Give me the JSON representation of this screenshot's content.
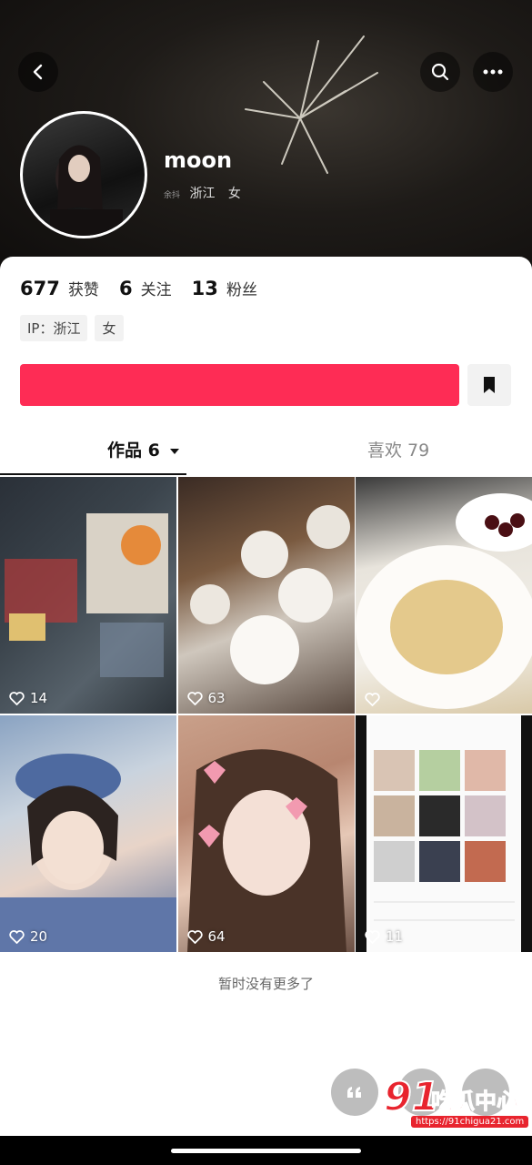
{
  "profile": {
    "username": "moon",
    "location_small": "余抖",
    "location": "浙江",
    "gender": "女"
  },
  "stats": {
    "likes_count": "677",
    "likes_label": "获赞",
    "following_count": "6",
    "following_label": "关注",
    "followers_count": "13",
    "followers_label": "粉丝"
  },
  "tags": {
    "ip": "IP：浙江",
    "gender": "女"
  },
  "follow_button": {
    "label": ""
  },
  "tabs": {
    "works": "作品 6",
    "likes": "喜欢 79"
  },
  "videos": [
    {
      "likes": "14"
    },
    {
      "likes": "63"
    },
    {
      "likes": ""
    },
    {
      "likes": "20"
    },
    {
      "likes": "64"
    },
    {
      "likes": "11"
    }
  ],
  "footer": {
    "no_more": "暂时没有更多了"
  },
  "watermark": {
    "number": "91",
    "text": "吃瓜中心",
    "url": "https://91chigua21.com"
  },
  "colors": {
    "accent": "#fe2c55",
    "watermark": "#e8242e"
  },
  "icons": [
    "back-icon",
    "search-icon",
    "more-icon",
    "bookmark-icon",
    "heart-icon",
    "quote-icon"
  ]
}
